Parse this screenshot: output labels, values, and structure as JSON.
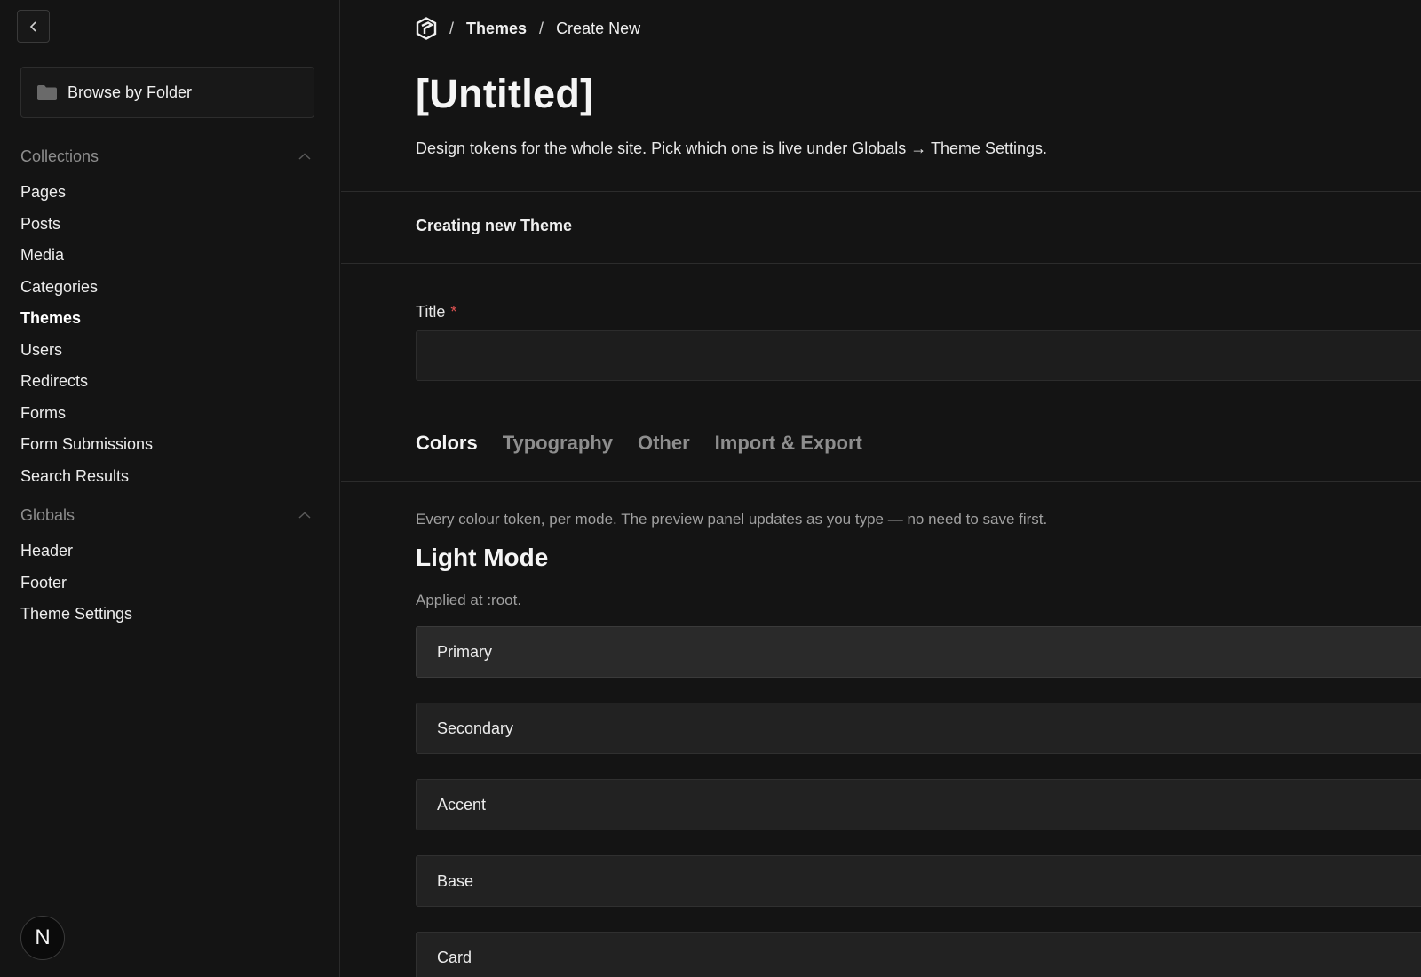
{
  "sidebar": {
    "browse_folder_label": "Browse by Folder",
    "collections": {
      "label": "Collections",
      "items": [
        {
          "label": "Pages"
        },
        {
          "label": "Posts"
        },
        {
          "label": "Media"
        },
        {
          "label": "Categories"
        },
        {
          "label": "Themes",
          "active": true
        },
        {
          "label": "Users"
        },
        {
          "label": "Redirects"
        },
        {
          "label": "Forms"
        },
        {
          "label": "Form Submissions"
        },
        {
          "label": "Search Results"
        }
      ]
    },
    "globals": {
      "label": "Globals",
      "items": [
        {
          "label": "Header"
        },
        {
          "label": "Footer"
        },
        {
          "label": "Theme Settings"
        }
      ]
    },
    "avatar_initial": "N"
  },
  "breadcrumb": {
    "sep": "/",
    "items": [
      "Themes",
      "Create New"
    ]
  },
  "page": {
    "title": "[Untitled]",
    "description": "Design tokens for the whole site. Pick which one is live under Globals → Theme Settings.",
    "status": "Creating new Theme"
  },
  "form": {
    "title_label": "Title",
    "required_mark": "*",
    "title_value": "",
    "title_placeholder": ""
  },
  "tabs": [
    {
      "label": "Colors",
      "active": true
    },
    {
      "label": "Typography"
    },
    {
      "label": "Other"
    },
    {
      "label": "Import & Export"
    }
  ],
  "colors_tab": {
    "hint": "Every colour token, per mode. The preview panel updates as you type — no need to save first.",
    "section_title": "Light Mode",
    "section_sub": "Applied at :root.",
    "rows": [
      {
        "label": "Primary"
      },
      {
        "label": "Secondary"
      },
      {
        "label": "Accent"
      },
      {
        "label": "Base"
      },
      {
        "label": "Card"
      }
    ]
  },
  "theme": {
    "background": "#141414",
    "required": "#e05353"
  }
}
